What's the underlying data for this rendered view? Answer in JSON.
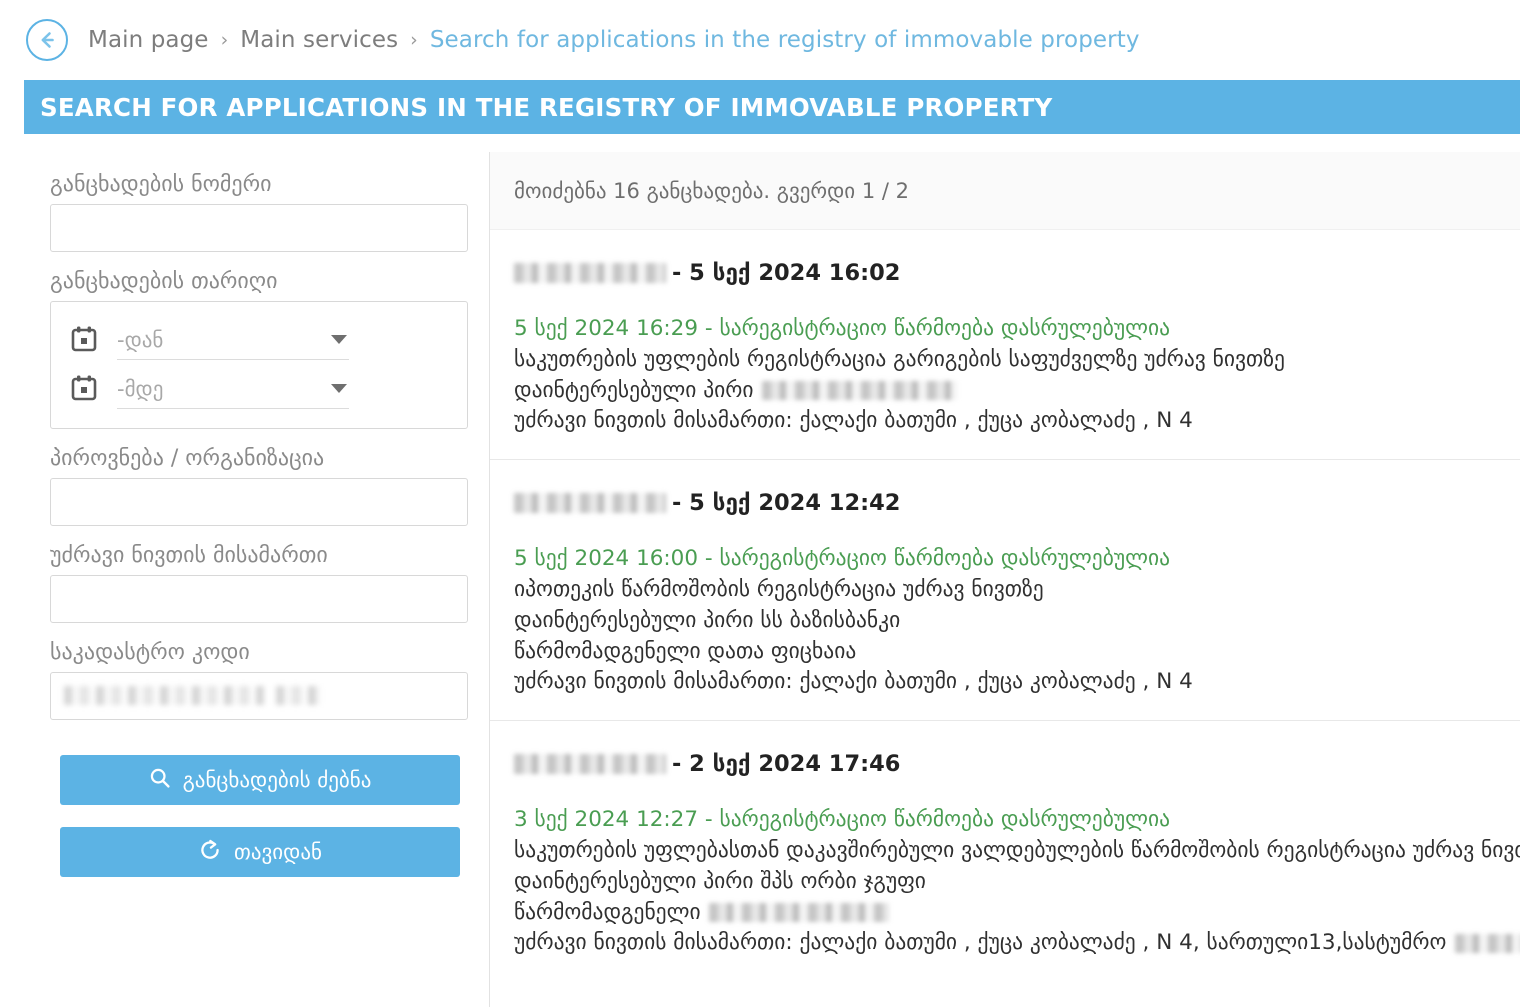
{
  "breadcrumb": {
    "back_icon": "arrow-left-icon",
    "items": [
      {
        "label": "Main page",
        "active": false
      },
      {
        "label": "Main services",
        "active": false
      },
      {
        "label": "Search for applications in the registry of immovable property",
        "active": true
      }
    ],
    "separator": "›"
  },
  "banner": {
    "title": "SEARCH FOR APPLICATIONS IN THE REGISTRY OF IMMOVABLE PROPERTY",
    "background": "#5cb3e4"
  },
  "sidebar": {
    "application_number": {
      "label": "განცხადების ნომერი",
      "value": "",
      "placeholder": ""
    },
    "application_date": {
      "label": "განცხადების თარიღი",
      "from_placeholder": "-დან",
      "to_placeholder": "-მდე",
      "from_value": "",
      "to_value": "",
      "calendar_icon": "calendar-icon",
      "caret_icon": "chevron-down-icon"
    },
    "person_org": {
      "label": "პიროვნება / ორგანიზაცია",
      "value": "",
      "placeholder": ""
    },
    "property_address": {
      "label": "უძრავი ნივთის მისამართი",
      "value": "",
      "placeholder": ""
    },
    "cadastral_code": {
      "label": "საკადასტრო კოდი",
      "value": "",
      "placeholder": "",
      "redacted": true
    },
    "search_button": {
      "label": "განცხადების ძებნა",
      "icon": "search-icon"
    },
    "reset_button": {
      "label": "თავიდან",
      "icon": "refresh-icon"
    }
  },
  "results": {
    "summary": "მოიძებნა 16 განცხადება. გვერდი 1 / 2",
    "total_count": 16,
    "page": 1,
    "page_count": 2,
    "items": [
      {
        "applicant_redacted": true,
        "title_date": "- 5 სექ 2024 16:02",
        "status_line": "5 სექ 2024 16:29 - სარეგისტრაციო წარმოება დასრულებულია",
        "lines": [
          {
            "text": "საკუთრების უფლების რეგისტრაცია გარიგების საფუძველზე უძრავ ნივთზე",
            "redact_after": false
          },
          {
            "text": "დაინტერესებული პირი",
            "redact_after": true
          },
          {
            "text": "უძრავი ნივთის მისამართი: ქალაქი ბათუმი , ქუცა კობალაძე , N 4",
            "redact_after": false
          }
        ]
      },
      {
        "applicant_redacted": true,
        "title_date": "- 5 სექ 2024 12:42",
        "status_line": "5 სექ 2024 16:00 - სარეგისტრაციო წარმოება დასრულებულია",
        "lines": [
          {
            "text": "იპოთეკის წარმოშობის რეგისტრაცია უძრავ ნივთზე",
            "redact_after": false
          },
          {
            "text": "დაინტერესებული პირი სს ბაზისბანკი",
            "redact_after": false
          },
          {
            "text": "წარმომადგენელი დათა ფიცხაია",
            "redact_after": false
          },
          {
            "text": "უძრავი ნივთის მისამართი: ქალაქი ბათუმი , ქუცა კობალაძე , N 4",
            "redact_after": false
          }
        ]
      },
      {
        "applicant_redacted": true,
        "title_date": "- 2 სექ 2024 17:46",
        "status_line": "3 სექ 2024 12:27 - სარეგისტრაციო წარმოება დასრულებულია",
        "lines": [
          {
            "text": "საკუთრების უფლებასთან დაკავშირებული ვალდებულების წარმოშობის რეგისტრაცია უძრავ ნივთზე",
            "redact_after": false
          },
          {
            "text": "დაინტერესებული პირი შპს ორბი ჯგუფი",
            "redact_after": false
          },
          {
            "text": "წარმომადგენელი",
            "redact_after": true
          },
          {
            "text": "უძრავი ნივთის მისამართი: ქალაქი ბათუმი , ქუცა კობალაძე , N 4, სართული13,სასტუმრო",
            "redact_after": true
          }
        ]
      }
    ]
  },
  "colors": {
    "accent_blue": "#5cb3e4",
    "status_green": "#4a9d52",
    "label_gray": "#8a8a8a",
    "text_dark": "#303030"
  }
}
